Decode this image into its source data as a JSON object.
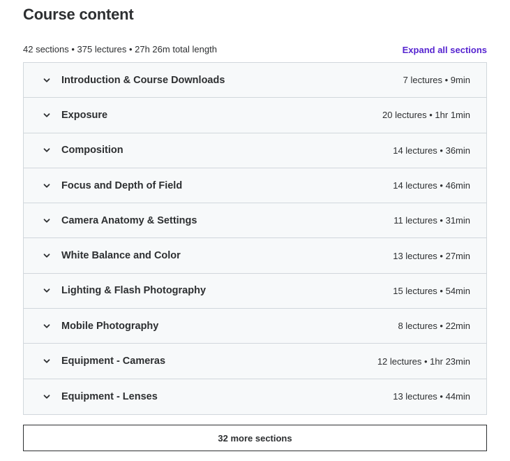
{
  "header": {
    "title": "Course content",
    "summary": "42 sections • 375 lectures • 27h 26m total length",
    "expand_all_label": "Expand all sections"
  },
  "colors": {
    "accent": "#5624d0",
    "section_bg": "#f7f9fa",
    "border": "#d1d7dc",
    "text": "#2d2f31"
  },
  "sections": [
    {
      "icon": "chevron-down-icon",
      "title": "Introduction & Course Downloads",
      "meta": "7 lectures • 9min"
    },
    {
      "icon": "chevron-down-icon",
      "title": "Exposure",
      "meta": "20 lectures • 1hr 1min"
    },
    {
      "icon": "chevron-down-icon",
      "title": "Composition",
      "meta": "14 lectures • 36min"
    },
    {
      "icon": "chevron-down-icon",
      "title": "Focus and Depth of Field",
      "meta": "14 lectures • 46min"
    },
    {
      "icon": "chevron-down-icon",
      "title": "Camera Anatomy & Settings",
      "meta": "11 lectures • 31min"
    },
    {
      "icon": "chevron-down-icon",
      "title": "White Balance and Color",
      "meta": "13 lectures • 27min"
    },
    {
      "icon": "chevron-down-icon",
      "title": "Lighting & Flash Photography",
      "meta": "15 lectures • 54min"
    },
    {
      "icon": "chevron-down-icon",
      "title": "Mobile Photography",
      "meta": "8 lectures • 22min"
    },
    {
      "icon": "chevron-down-icon",
      "title": "Equipment - Cameras",
      "meta": "12 lectures • 1hr 23min"
    },
    {
      "icon": "chevron-down-icon",
      "title": "Equipment - Lenses",
      "meta": "13 lectures • 44min"
    }
  ],
  "more_sections_label": "32 more sections"
}
